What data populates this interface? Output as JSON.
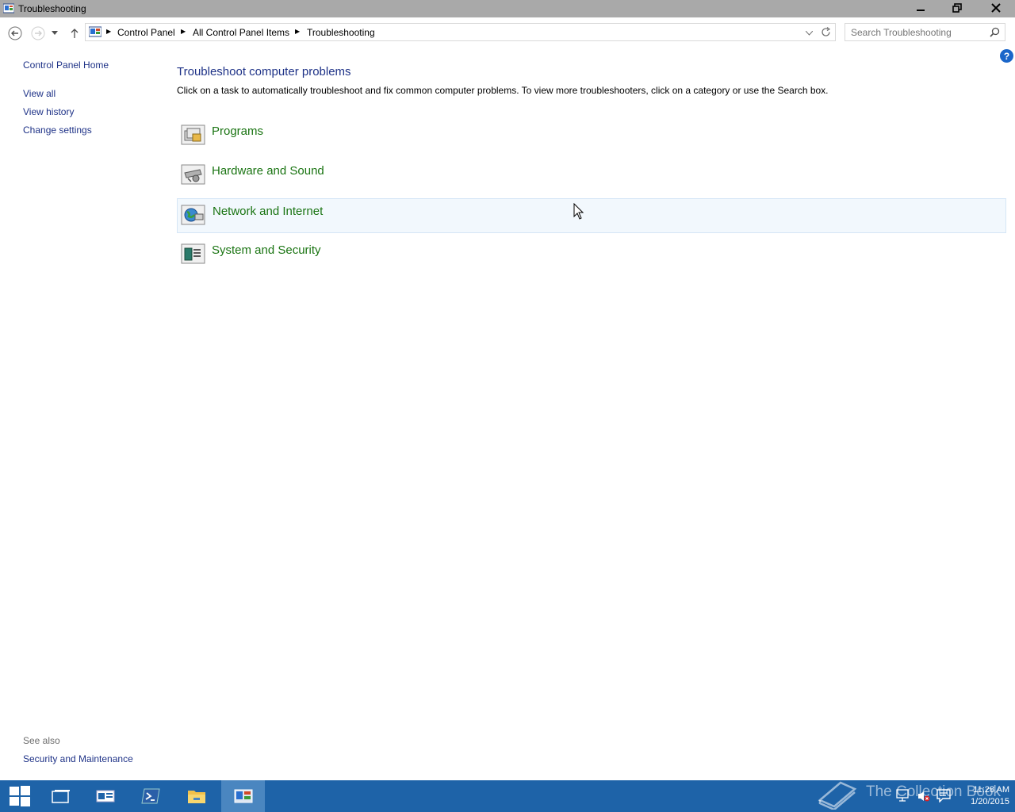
{
  "window": {
    "title": "Troubleshooting",
    "controls": {
      "minimize_icon": "minimize-icon",
      "maximize_icon": "restore-icon",
      "close_icon": "close-icon"
    }
  },
  "nav": {
    "breadcrumb": [
      "Control Panel",
      "All Control Panel Items",
      "Troubleshooting"
    ],
    "search_placeholder": "Search Troubleshooting"
  },
  "sidebar": {
    "home": "Control Panel Home",
    "links": [
      "View all",
      "View history",
      "Change settings"
    ],
    "see_also_title": "See also",
    "see_also_links": [
      "Security and Maintenance"
    ]
  },
  "main": {
    "heading": "Troubleshoot computer problems",
    "description": "Click on a task to automatically troubleshoot and fix common computer problems. To view more troubleshooters, click on a category or use the Search box.",
    "categories": [
      {
        "label": "Programs",
        "icon": "programs-icon"
      },
      {
        "label": "Hardware and Sound",
        "icon": "hardware-sound-icon"
      },
      {
        "label": "Network and Internet",
        "icon": "network-internet-icon"
      },
      {
        "label": "System and Security",
        "icon": "system-security-icon"
      }
    ]
  },
  "taskbar": {
    "watermark": "The Collection Book",
    "time": "11:28 AM",
    "date": "1/20/2015"
  },
  "colors": {
    "link": "#1e3287",
    "category_link": "#1a7412",
    "taskbar": "#1e63a8",
    "titlebar": "#a9a9a9",
    "hover_row": "#f2f8fd"
  }
}
